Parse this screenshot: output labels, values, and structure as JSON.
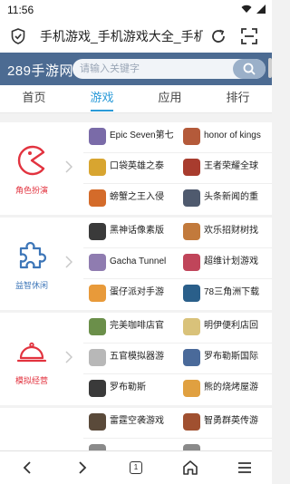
{
  "status": {
    "time": "11:56"
  },
  "browser": {
    "url_text": "手机游戏_手机游戏大全_手机游戏"
  },
  "site": {
    "logo": "289手游网",
    "search_placeholder": "请输入关键字"
  },
  "tabs": [
    {
      "label": "首页",
      "active": false
    },
    {
      "label": "游戏",
      "active": true
    },
    {
      "label": "应用",
      "active": false
    },
    {
      "label": "排行",
      "active": false
    }
  ],
  "categories": [
    {
      "label": "角色扮演",
      "icon": "pacman-icon",
      "color": "#e2333f",
      "games": [
        {
          "name": "Epic Seven第七",
          "thumb": "#7a6ba8"
        },
        {
          "name": "honor of kings",
          "thumb": "#b45a3a"
        },
        {
          "name": "口袋英雄之泰",
          "thumb": "#d8a530"
        },
        {
          "name": "王者荣耀全球",
          "thumb": "#a83c2e"
        },
        {
          "name": "螃蟹之王入侵",
          "thumb": "#d46b2a"
        },
        {
          "name": "头条新闻的重",
          "thumb": "#4f5a6e"
        }
      ]
    },
    {
      "label": "益智休闲",
      "icon": "puzzle-icon",
      "color": "#3d76b8",
      "games": [
        {
          "name": "黑神话像素版",
          "thumb": "#3a3a3a"
        },
        {
          "name": "欢乐招财树找",
          "thumb": "#c27a3c"
        },
        {
          "name": "Gacha Tunnel",
          "thumb": "#8f7cb0"
        },
        {
          "name": "超维计划游戏",
          "thumb": "#c0455a"
        },
        {
          "name": "蛋仔派对手游",
          "thumb": "#e89a3a"
        },
        {
          "name": "78三角洲下载",
          "thumb": "#2a5f8a"
        }
      ]
    },
    {
      "label": "模拟经营",
      "icon": "cloche-icon",
      "color": "#e2333f",
      "games": [
        {
          "name": "完美咖啡店官",
          "thumb": "#6b8f4a"
        },
        {
          "name": "明伊便利店回",
          "thumb": "#d9c27a"
        },
        {
          "name": "五官模拟器游",
          "thumb": "#b8b8b8"
        },
        {
          "name": "罗布勒斯国际",
          "thumb": "#4a6a9a"
        },
        {
          "name": "罗布勒斯",
          "thumb": "#3a3a3a"
        },
        {
          "name": "熊的烧烤屋游",
          "thumb": "#e0a040"
        }
      ]
    },
    {
      "label": "",
      "icon": "partial-category-icon",
      "color": "#f0a030",
      "games": [
        {
          "name": "雷霆空袭游戏",
          "thumb": "#5a4a3a"
        },
        {
          "name": "智勇群英传游",
          "thumb": "#a05030"
        },
        {
          "name": "",
          "thumb": "#8a8a8a"
        },
        {
          "name": "",
          "thumb": "#8a8a8a"
        }
      ]
    }
  ],
  "bottom_bar": {
    "tab_count": "1"
  }
}
